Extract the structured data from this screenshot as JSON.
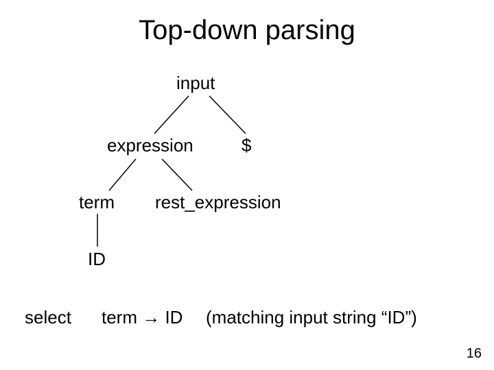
{
  "title": "Top-down parsing",
  "tree": {
    "root": "input",
    "n1": "expression",
    "n2": "$",
    "n3": "term",
    "n4": "rest_expression",
    "n5": "ID"
  },
  "caption": {
    "label": "select",
    "rule": "term → ID",
    "note": "(matching input string “ID”)"
  },
  "page_number": "16"
}
